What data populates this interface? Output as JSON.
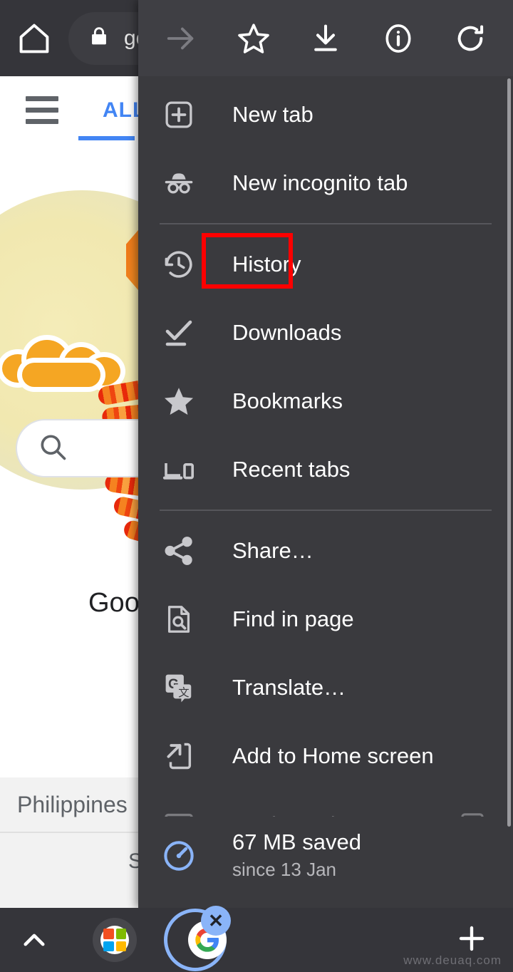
{
  "browser": {
    "home_icon": "home-icon",
    "omnibox": {
      "lock_icon": "lock-icon",
      "url_text": "go"
    }
  },
  "page": {
    "hamburger_icon": "hamburger-menu-icon",
    "tab_label": "ALL",
    "doodle_alt": "google-doodle-lantern-dragon",
    "search_icon": "search-icon",
    "search_placeholder": "",
    "brand_text": "Googl",
    "region_label": "Philippines",
    "footer_partial_text": "S"
  },
  "menu": {
    "top_actions": [
      {
        "name": "forward-arrow-icon",
        "label": "Forward",
        "enabled": false
      },
      {
        "name": "star-outline-icon",
        "label": "Bookmark",
        "enabled": true
      },
      {
        "name": "download-icon",
        "label": "Download page",
        "enabled": true
      },
      {
        "name": "info-circle-icon",
        "label": "Page info",
        "enabled": true
      },
      {
        "name": "reload-icon",
        "label": "Reload",
        "enabled": true
      }
    ],
    "items": [
      {
        "icon": "new-tab-icon",
        "label": "New tab",
        "dimmed": false
      },
      {
        "icon": "incognito-icon",
        "label": "New incognito tab",
        "dimmed": false
      },
      {
        "icon": "history-icon",
        "label": "History",
        "dimmed": false
      },
      {
        "icon": "downloads-icon",
        "label": "Downloads",
        "dimmed": false
      },
      {
        "icon": "bookmarks-star-icon",
        "label": "Bookmarks",
        "dimmed": false
      },
      {
        "icon": "recent-tabs-icon",
        "label": "Recent tabs",
        "dimmed": false
      },
      {
        "icon": "share-icon",
        "label": "Share…",
        "dimmed": false
      },
      {
        "icon": "find-in-page-icon",
        "label": "Find in page",
        "dimmed": false
      },
      {
        "icon": "translate-icon",
        "label": "Translate…",
        "dimmed": false
      },
      {
        "icon": "add-to-home-icon",
        "label": "Add to Home screen",
        "dimmed": false
      },
      {
        "icon": "desktop-site-icon",
        "label": "Desktop site",
        "dimmed": true
      }
    ],
    "highlight": {
      "target_label": "History",
      "color": "#fe0000"
    },
    "data_saver": {
      "icon": "speedometer-icon",
      "title": "67 MB saved",
      "subtitle": "since 13 Jan",
      "accent_color": "#8ab4f8"
    }
  },
  "bottom_bar": {
    "expand_icon": "chevron-up-icon",
    "tabs": [
      {
        "name": "microsoft-tab",
        "icon": "microsoft-logo-icon",
        "selected": false
      },
      {
        "name": "google-tab",
        "icon": "google-logo-icon",
        "selected": true,
        "close_label": "✕"
      }
    ],
    "new_tab_icon": "plus-icon"
  },
  "watermark": "www.deuaq.com",
  "colors": {
    "menu_bg": "#3a3a3e",
    "toolbar_bg": "#35353a",
    "accent_blue": "#4285f4",
    "highlight_red": "#fe0000",
    "saver_blue": "#8ab4f8"
  }
}
